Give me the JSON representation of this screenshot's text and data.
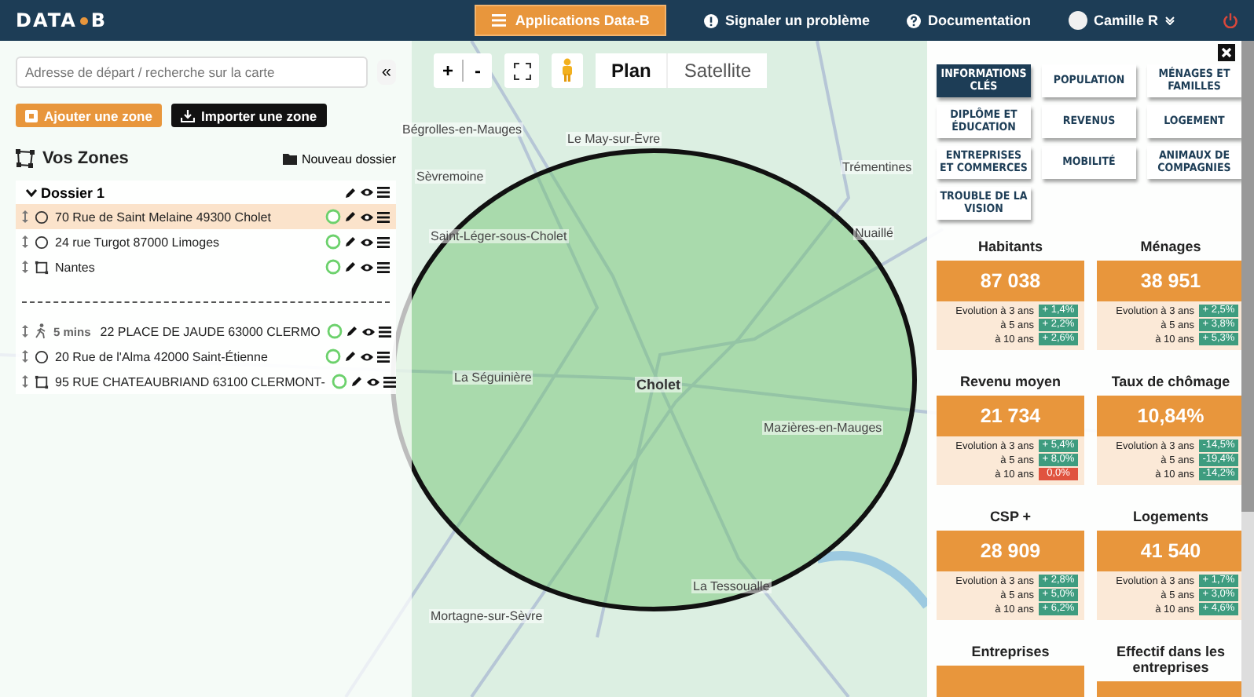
{
  "header": {
    "logo": {
      "left": "DATA",
      "right": "B"
    },
    "apps_button": "Applications Data-B",
    "links": [
      {
        "kind": "info",
        "label": "Signaler un problème"
      },
      {
        "kind": "help",
        "label": "Documentation"
      }
    ],
    "user": "Camille R"
  },
  "sidebar": {
    "search": {
      "placeholder": "Adresse de départ / recherche sur la carte"
    },
    "collapse": "«",
    "add_button": "Ajouter une zone",
    "import_button": "Importer une zone",
    "title": "Vos Zones",
    "new_folder": "Nouveau dossier",
    "folders": [
      {
        "name": "Dossier 1",
        "expanded": true,
        "zones": [
          {
            "kind": "circle",
            "label": "70 Rue de Saint Melaine 49300 Cholet",
            "selected": true
          },
          {
            "kind": "circle",
            "label": "24 rue Turgot 87000 Limoges",
            "selected": false
          },
          {
            "kind": "polygon",
            "label": "Nantes",
            "selected": false
          }
        ]
      }
    ],
    "zones": [
      {
        "kind": "isochrone",
        "duration": "5 mins",
        "label": "22 PLACE DE JAUDE 63000 CLERMO",
        "selected": false
      },
      {
        "kind": "circle",
        "label": "20 Rue de l'Alma 42000 Saint-Étienne",
        "selected": false
      },
      {
        "kind": "polygon",
        "label": "95 RUE CHATEAUBRIAND 63100 CLERMONT-",
        "selected": false
      }
    ]
  },
  "map": {
    "zoom_in": "+",
    "zoom_out": "-",
    "layers": [
      {
        "label": "Plan",
        "selected": true
      },
      {
        "label": "Satellite",
        "selected": false
      }
    ],
    "labels": [
      "Bégrolles-en-Mauges",
      "Le May-sur-Èvre",
      "Sèvremoine",
      "Trémentines",
      "Saint-Léger-sous-Cholet",
      "Nuaillé",
      "La Séguinière",
      "Cholet",
      "Mazières-en-Mauges",
      "La Tessoualle",
      "Mortagne-sur-Sèvre"
    ]
  },
  "panel": {
    "categories": [
      {
        "label": "INFORMATIONS CLÉS",
        "selected": true
      },
      {
        "label": "POPULATION",
        "selected": false
      },
      {
        "label": "MÉNAGES ET FAMILLES",
        "selected": false
      },
      {
        "label": "DIPLÔME ET ÉDUCATION",
        "selected": false
      },
      {
        "label": "REVENUS",
        "selected": false
      },
      {
        "label": "LOGEMENT",
        "selected": false
      },
      {
        "label": "ENTREPRISES ET COMMERCES",
        "selected": false
      },
      {
        "label": "MOBILITÉ",
        "selected": false
      },
      {
        "label": "ANIMAUX DE COMPAGNIES",
        "selected": false
      },
      {
        "label": "TROUBLE DE LA VISION",
        "selected": false
      }
    ],
    "stats": [
      {
        "title": "Habitants",
        "value": "87 038",
        "evolutions": [
          {
            "label": "Evolution à 3 ans",
            "change": "+ 1,4%",
            "color": "#3e9c7f"
          },
          {
            "label": "à 5 ans",
            "change": "+ 2,2%",
            "color": "#3e9c7f"
          },
          {
            "label": "à 10 ans",
            "change": "+ 2,6%",
            "color": "#3e9c7f"
          }
        ]
      },
      {
        "title": "Ménages",
        "value": "38 951",
        "evolutions": [
          {
            "label": "Evolution à 3 ans",
            "change": "+ 2,5%",
            "color": "#3e9c7f"
          },
          {
            "label": "à 5 ans",
            "change": "+ 3,8%",
            "color": "#3e9c7f"
          },
          {
            "label": "à 10 ans",
            "change": "+ 5,3%",
            "color": "#3e9c7f"
          }
        ]
      },
      {
        "title": "Revenu moyen",
        "value": "21 734",
        "evolutions": [
          {
            "label": "Evolution à 3 ans",
            "change": "+ 5,4%",
            "color": "#3e9c7f"
          },
          {
            "label": "à 5 ans",
            "change": "+ 8,0%",
            "color": "#3e9c7f"
          },
          {
            "label": "à 10 ans",
            "change": "0,0%",
            "color": "#e0533f"
          }
        ]
      },
      {
        "title": "Taux de chômage",
        "value": "10,84%",
        "evolutions": [
          {
            "label": "Evolution à 3 ans",
            "change": "-14,5%",
            "color": "#3e9c7f"
          },
          {
            "label": "à 5 ans",
            "change": "-19,4%",
            "color": "#3e9c7f"
          },
          {
            "label": "à 10 ans",
            "change": "-14,2%",
            "color": "#3e9c7f"
          }
        ]
      },
      {
        "title": "CSP +",
        "value": "28 909",
        "evolutions": [
          {
            "label": "Evolution à 3 ans",
            "change": "+ 2,8%",
            "color": "#3e9c7f"
          },
          {
            "label": "à 5 ans",
            "change": "+ 5,0%",
            "color": "#3e9c7f"
          },
          {
            "label": "à 10 ans",
            "change": "+ 6,2%",
            "color": "#3e9c7f"
          }
        ]
      },
      {
        "title": "Logements",
        "value": "41 540",
        "evolutions": [
          {
            "label": "Evolution à 3 ans",
            "change": "+ 1,7%",
            "color": "#3e9c7f"
          },
          {
            "label": "à 5 ans",
            "change": "+ 3,0%",
            "color": "#3e9c7f"
          },
          {
            "label": "à 10 ans",
            "change": "+ 4,6%",
            "color": "#3e9c7f"
          }
        ]
      },
      {
        "title": "Entreprises"
      },
      {
        "title": "Effectif dans les entreprises"
      }
    ]
  }
}
